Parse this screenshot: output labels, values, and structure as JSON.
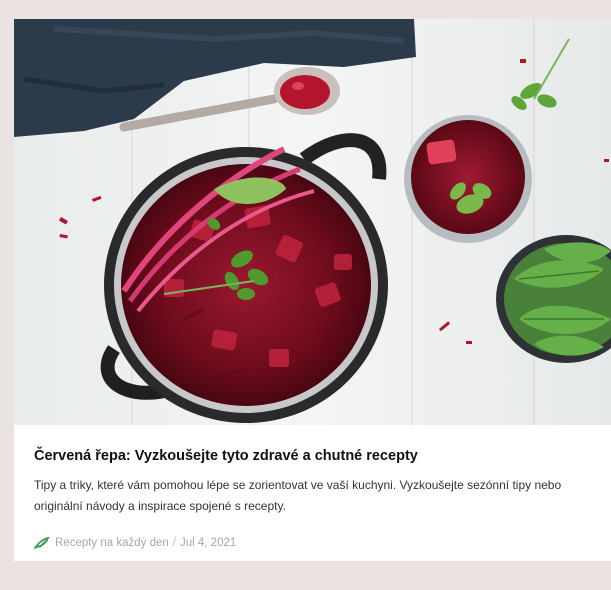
{
  "article": {
    "title": "Červená řepa: Vyzkoušejte tyto zdravé a chutné recepty",
    "description": "Tipy a triky, které vám pomohou lépe se zorientovat ve vaší kuchyni. Vyzkoušejte sezónní tipy nebo originální návody a inspirace spojené s recepty.",
    "source": "Recepty na každý den",
    "separator": "/",
    "date": "Jul 4, 2021"
  },
  "image": {
    "subject": "beet stew in pot, beet soup in bowl, bowl of beet greens on white wooden table",
    "colors": {
      "table": "#eef0f0",
      "napkin": "#2c3b4a",
      "stew": "#7e0f22",
      "greens": "#5ea53a",
      "pot": "#2a2a2c"
    }
  },
  "brand": {
    "logo_icon": "leaf-logo-icon",
    "logo_color": "#3a9a5a"
  }
}
